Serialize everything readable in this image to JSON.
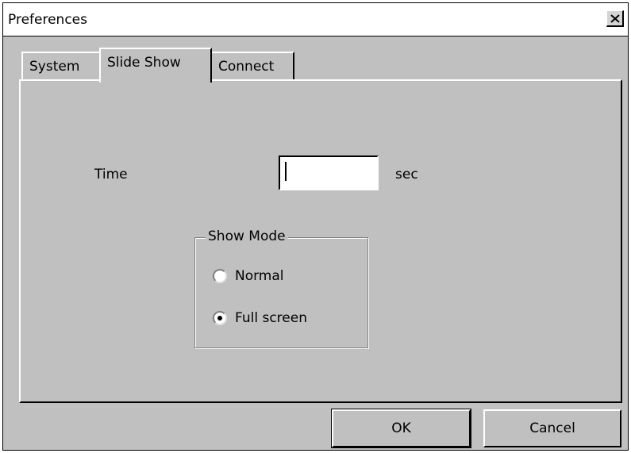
{
  "window": {
    "title": "Preferences",
    "close_icon": "close-icon"
  },
  "tabs": [
    {
      "label": "System",
      "selected": false
    },
    {
      "label": "Slide Show",
      "selected": true
    },
    {
      "label": "Connect",
      "selected": false
    }
  ],
  "slideshow": {
    "time_label": "Time",
    "time_value": "",
    "unit_label": "sec",
    "show_mode": {
      "legend": "Show Mode",
      "options": [
        {
          "label": "Normal",
          "checked": false
        },
        {
          "label": "Full screen",
          "checked": true
        }
      ]
    }
  },
  "buttons": {
    "ok_label": "OK",
    "cancel_label": "Cancel"
  }
}
